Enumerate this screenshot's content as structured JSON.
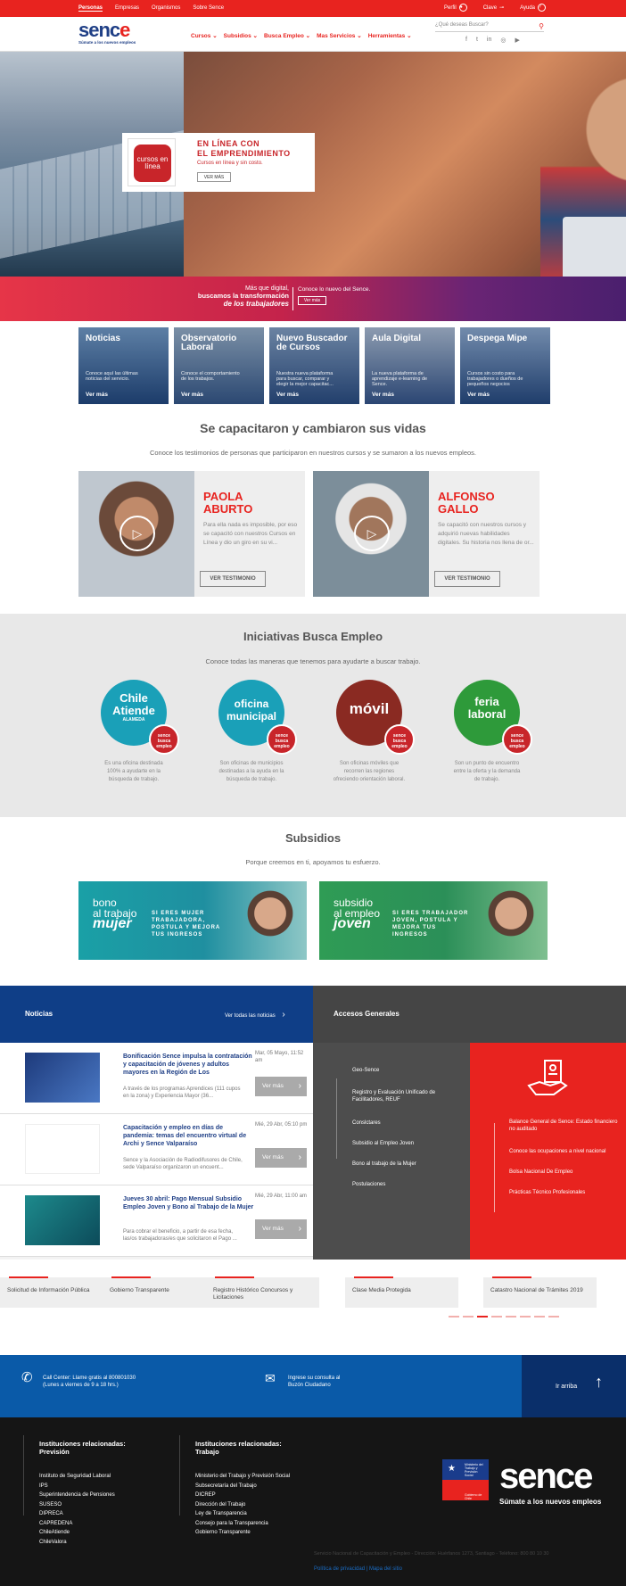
{
  "topbar": {
    "tabs": [
      "Personas",
      "Empresas",
      "Organismos",
      "Sobre Sence"
    ],
    "perfil": "Perfil",
    "clave": "Clave",
    "ayuda": "Ayuda",
    "perfil_icon": "user-icon",
    "clave_icon": "key-icon",
    "ayuda_icon": "question-icon"
  },
  "logo": {
    "word_a": "senc",
    "word_b": "e",
    "tag": "Súmate a los nuevos empleos"
  },
  "nav": [
    "Cursos",
    "Subsidios",
    "Busca Empleo",
    "Mas Servicios",
    "Herramientas"
  ],
  "search": {
    "placeholder": "¿Qué deseas Buscar?"
  },
  "social": [
    "facebook-icon",
    "twitter-icon",
    "linkedin-icon",
    "instagram-icon",
    "youtube-icon"
  ],
  "hero": {
    "badge": "cursos en línea",
    "badge_sub": "sence",
    "title_1": "EN LÍNEA CON",
    "title_2": "EL EMPRENDIMIENTO",
    "sub": "Cursos en línea y sin costo.",
    "btn": "VER MÁS"
  },
  "band": {
    "l1": "Más que digital,",
    "l2": "buscamos la transformación",
    "l3": "de los trabajadores",
    "r1": "Conoce lo nuevo del Sence.",
    "btn": "Ver más"
  },
  "tiles": [
    {
      "title": "Noticias",
      "desc": "Conoce aquí las últimas noticias del servicio.",
      "more": "Ver más"
    },
    {
      "title": "Observatorio Laboral",
      "desc": "Conoce el comportamiento de los trabajos.",
      "more": "Ver más"
    },
    {
      "title": "Nuevo Buscador de Cursos",
      "desc": "Nuestra nueva plataforma para buscar, comparar y elegir la mejor capacitac...",
      "more": "Ver más"
    },
    {
      "title": "Aula Digital",
      "desc": "La nueva plataforma de aprendizaje e-learning de Sence.",
      "more": "Ver más"
    },
    {
      "title": "Despega Mipe",
      "desc": "Cursos sin costo para trabajadores o dueños de pequeños negocios",
      "more": "Ver más"
    }
  ],
  "testimonios": {
    "title": "Se capacitaron y cambiaron sus vidas",
    "sub": "Conoce los testimonios de personas que participaron en nuestros cursos y se sumaron a los nuevos empleos.",
    "items": [
      {
        "name_1": "PAOLA",
        "name_2": "ABURTO",
        "desc": "Para ella nada es imposible, por eso se capacitó con nuestros Cursos en Línea y dio un giro en su vi...",
        "btn": "VER TESTIMONIO"
      },
      {
        "name_1": "ALFONSO",
        "name_2": "GALLO",
        "desc": "Se capacitó con nuestros cursos y adquirió nuevas habilidades digitales. Su historia nos llena de or...",
        "btn": "VER TESTIMONIO"
      }
    ]
  },
  "iniciativas": {
    "title": "Iniciativas Busca Empleo",
    "sub": "Conoce todas las maneras que tenemos para ayudarte a buscar trabajo.",
    "items": [
      {
        "l1": "Chile",
        "l2": "Atiende",
        "l3": "ALAMEDA",
        "color": "#1aa0b8",
        "desc": "Es una oficina destinada 100% a ayudarte en la búsqueda de trabajo."
      },
      {
        "l1": "oficina",
        "l2": "municipal",
        "l3": "",
        "color": "#1aa0b8",
        "desc": "Son oficinas de municipios destinadas a la ayuda en la búsqueda de trabajo."
      },
      {
        "l1": "móvil",
        "l2": "",
        "l3": "",
        "color": "#8a2a22",
        "desc": "Son oficinas móviles que recorren las regiones ofreciendo orientación laboral."
      },
      {
        "l1": "feria",
        "l2": "laboral",
        "l3": "",
        "color": "#2e9a3a",
        "desc": "Son un punto de encuentro entre la oferta y la demanda de trabajo."
      }
    ],
    "stamp": "sence busca empleo"
  },
  "subsidios": {
    "title": "Subsidios",
    "sub": "Porque creemos en ti, apoyamos tu esfuerzo.",
    "items": [
      {
        "t1": "bono",
        "t2": "al trabajo",
        "t3": "mujer",
        "txt": "SI ERES MUJER TRABAJADORA, POSTULA Y MEJORA TUS INGRESOS",
        "color": "#1d9aa0"
      },
      {
        "t1": "subsidio",
        "t2": "al empleo",
        "t3": "joven",
        "txt": "SI ERES TRABAJADOR JOVEN, POSTULA Y MEJORA TUS INGRESOS",
        "color": "#2f9c55"
      }
    ]
  },
  "noticias": {
    "title": "Noticias",
    "all": "Ver todas las noticias",
    "items": [
      {
        "title": "Bonificación Sence impulsa la contratación y capacitación de jóvenes y adultos mayores en la Región de Los",
        "ex": "A través de los programas Aprendices (111 cupos en la zona) y Experiencia Mayor (36...",
        "date": "Mar, 05 Mayo, 11:52 am",
        "more": "Ver más"
      },
      {
        "title": "Capacitación y empleo en días de pandemia: temas del encuentro virtual de Archi y Sence Valparaíso",
        "ex": "Sence y la Asociación de Radiodifusores de Chile, sede Valparaíso organizaron un encuent...",
        "date": "Mié, 29 Abr, 05:10 pm",
        "more": "Ver más"
      },
      {
        "title": "Jueves 30 abril: Pago Mensual Subsidio Empleo Joven y Bono al Trabajo de la Mujer",
        "ex": "Para cobrar el beneficio, a partir de esa fecha, las/os trabajadoras/es que solicitaron el Pago ...",
        "date": "Mié, 29 Abr, 11:00 am",
        "more": "Ver más"
      }
    ]
  },
  "accesos": {
    "title": "Accesos Generales",
    "list": [
      "Geo-Sence",
      "Registro y Evaluación Unificado de Facilitadores, REUF",
      "Conslctares",
      "Subsidio al Empleo Joven",
      "Bono al trabajo de la Mujer",
      "Postulaciones"
    ],
    "red": [
      "Balance General de Sence: Estado financiero no auditado",
      "Conoce las ocupaciones a nivel nacional",
      "Bolsa Nacional De Empleo",
      "Prácticas Técnico Profesionales"
    ]
  },
  "carousel": [
    "Solicitud de Información Pública",
    "Gobierno Transparente",
    "Registro Histórico Concursos y Licitaciones",
    "Clase Media Protegida",
    "Catastro Nacional de Trámites 2019"
  ],
  "contact": {
    "call_1": "Call Center: Llame gratis al 800801030",
    "call_2": "(Lunes a viernes de 9 a 18 hrs.)",
    "mail_1": "Ingrese su consulta al",
    "mail_2": "Buzón Ciudadano",
    "up": "Ir arriba"
  },
  "footer": {
    "prev_title_1": "Instituciones relacionadas:",
    "prev_title_2": "Previsión",
    "prev": [
      "Instituto de Seguridad Laboral",
      "IPS",
      "Superintendencia de Pensiones",
      "SUSESO",
      "DIPRECA",
      "CAPREDENA",
      "ChileAtiende",
      "ChileValora"
    ],
    "trab_title_1": "Instituciones relacionadas:",
    "trab_title_2": "Trabajo",
    "trab": [
      "Ministerio del Trabajo y Previsión Social",
      "Subsecretaría del Trabajo",
      "DICREP",
      "Dirección del Trabajo",
      "Ley de Transparencia",
      "Consejo para la Transparencia",
      "Gobierno Transparente"
    ],
    "gob": "Ministerio del Trabajo y Previsión Social",
    "gob_sub": "Gobierno de Chile",
    "logo": "sence",
    "tag": "Súmate a los nuevos empleos",
    "addr": "Servicio Nacional de Capacitación y Empleo - Dirección: Huérfanos 1273, Santiago - Teléfono: 800 80 10 30",
    "policy": "Política de privacidad",
    "sitemap": "Mapa del sitio"
  }
}
